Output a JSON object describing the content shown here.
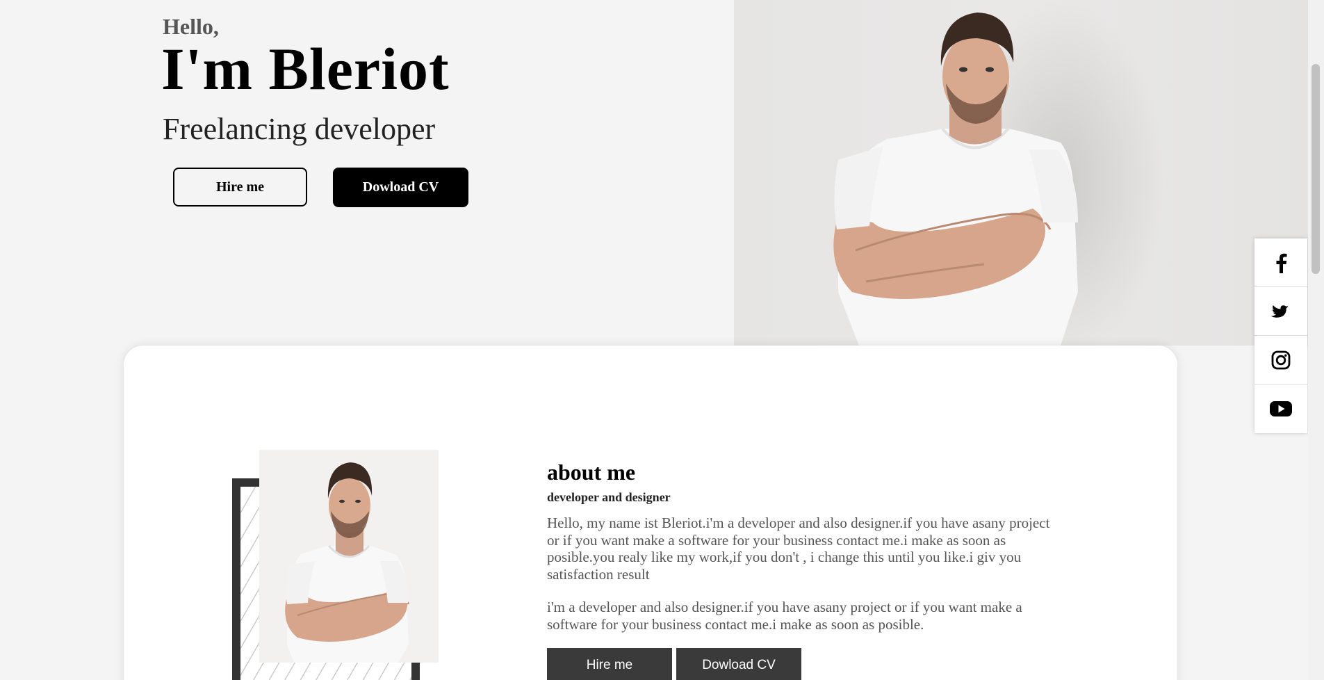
{
  "hero": {
    "greeting": "Hello,",
    "name": "I'm Bleriot",
    "role": "Freelancing developer",
    "hire_label": "Hire me",
    "cv_label": "Dowload CV"
  },
  "about": {
    "title": "about me",
    "subtitle": "developer and designer",
    "paragraph1": "Hello, my name ist Bleriot.i'm a developer and also designer.if you have asany project or if you want make a software for your business contact me.i make as soon as posible.you realy like my work,if you don't , i change this until you like.i giv you satisfaction result",
    "paragraph2": "i'm a developer and also designer.if you have asany project or if you want make a software for your business contact me.i make as soon as posible.",
    "hire_label": "Hire me",
    "cv_label": "Dowload CV"
  },
  "social": [
    {
      "icon": "facebook-icon"
    },
    {
      "icon": "twitter-icon"
    },
    {
      "icon": "instagram-icon"
    },
    {
      "icon": "youtube-icon"
    }
  ],
  "colors": {
    "background": "#f4f4f4",
    "primary": "#000000",
    "card": "#ffffff",
    "button_dark": "#3a3a3a"
  }
}
